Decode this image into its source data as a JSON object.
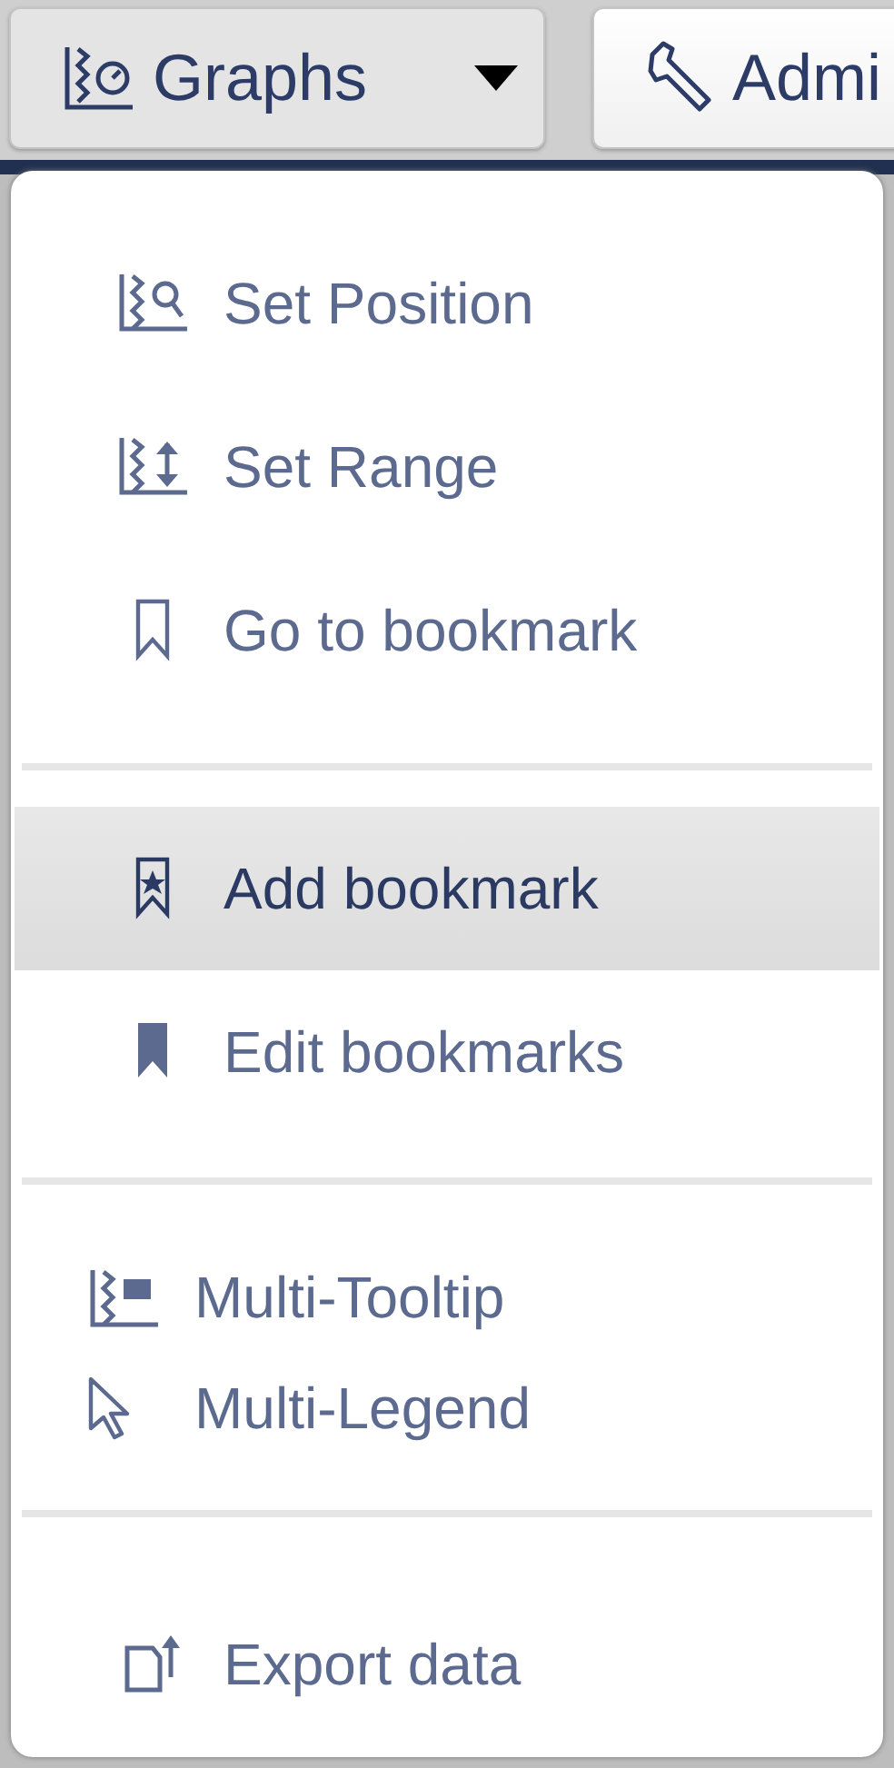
{
  "toolbar": {
    "buttons": [
      {
        "label": "Graphs",
        "has_caret": true,
        "selected": true
      },
      {
        "label": "Admi",
        "has_caret": false,
        "selected": false
      }
    ]
  },
  "menu": {
    "sections": [
      {
        "kind": "spaced",
        "items": [
          {
            "label": "Set Position",
            "selected": false
          },
          {
            "label": "Set Range",
            "selected": false
          },
          {
            "label": "Go to bookmark",
            "selected": false
          }
        ]
      },
      {
        "kind": "spaced",
        "items": [
          {
            "label": "Add bookmark",
            "selected": true
          },
          {
            "label": "Edit bookmarks",
            "selected": false
          }
        ]
      },
      {
        "kind": "compact",
        "items": [
          {
            "label": "Multi-Tooltip",
            "selected": false
          },
          {
            "label": "Multi-Legend",
            "selected": false
          }
        ]
      },
      {
        "kind": "spaced",
        "items": [
          {
            "label": "Export data",
            "selected": false
          }
        ]
      }
    ]
  }
}
